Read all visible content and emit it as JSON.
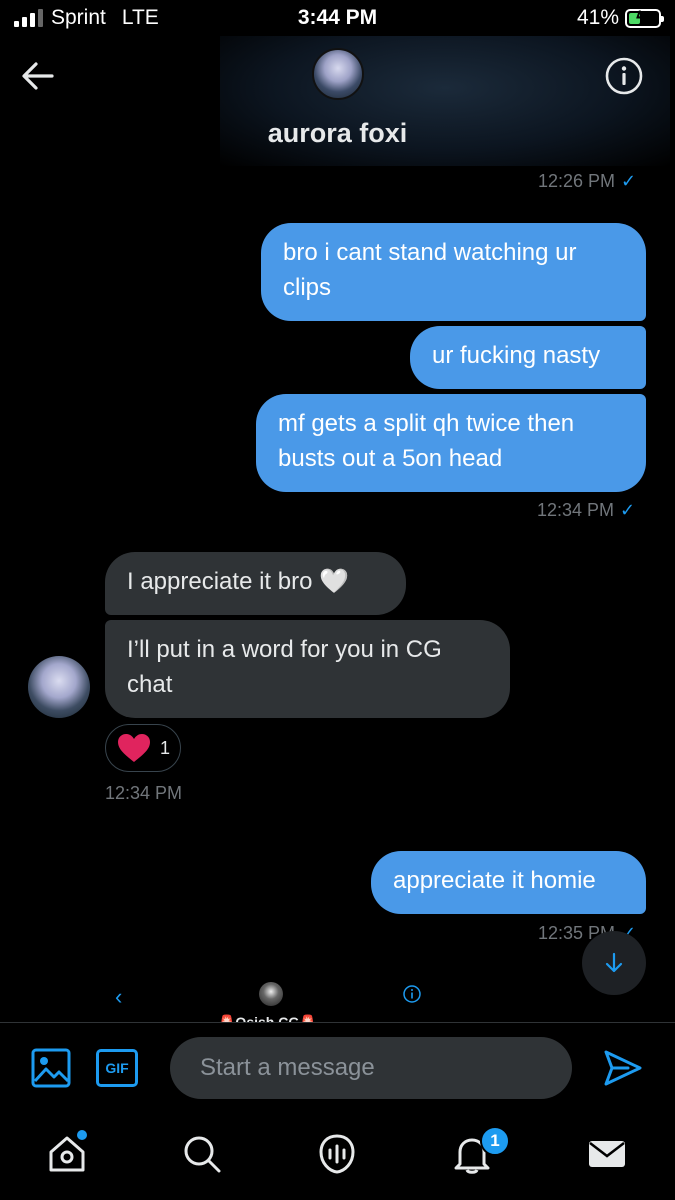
{
  "status_bar": {
    "carrier": "Sprint",
    "network": "LTE",
    "time": "3:44 PM",
    "battery": "41%",
    "battery_level": 0.41
  },
  "header": {
    "name": "aurora foxi",
    "back_icon": "arrow-left-icon",
    "info_icon": "info-icon"
  },
  "messages": {
    "ts1": "12:26 PM",
    "out1": "bro i cant stand watching ur clips",
    "out2": "ur fucking nasty",
    "out3": "mf gets a split qh twice then busts out a 5on head",
    "ts2": "12:34 PM",
    "in1": "I appreciate it bro 🤍",
    "in2": "I’ll put in a word for you in CG chat",
    "reaction_count": "1",
    "ts3": "12:34 PM",
    "out4": "appreciate it homie",
    "ts4": "12:35 PM"
  },
  "mini_header": {
    "name": "🚨Osish CG🚨"
  },
  "composer": {
    "placeholder": "Start a message",
    "gif_label": "GIF"
  },
  "tabbar": {
    "notifications_badge": "1"
  },
  "colors": {
    "accent": "#1d9bf0",
    "outgoing_bubble": "#4a99e8",
    "incoming_bubble": "#2f3336",
    "heart": "#f91880"
  }
}
